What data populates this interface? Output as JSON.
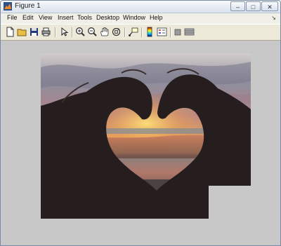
{
  "window": {
    "title": "Figure 1",
    "icon": "matlab-figure-icon",
    "controls": [
      "minimize-icon",
      "maximize-icon",
      "close-icon"
    ]
  },
  "menubar": {
    "items": [
      "File",
      "Edit",
      "View",
      "Insert",
      "Tools",
      "Desktop",
      "Window",
      "Help"
    ],
    "overflow_icon": "arrow-icon"
  },
  "toolbar": {
    "buttons": [
      "new-figure-icon",
      "open-file-icon",
      "save-icon",
      "print-icon",
      "edit-plot-icon",
      "zoom-in-icon",
      "zoom-out-icon",
      "pan-icon",
      "rotate-3d-icon",
      "data-cursor-icon",
      "colorbar-icon",
      "legend-icon",
      "hide-plot-tools-icon",
      "show-plot-tools-icon"
    ]
  },
  "figure": {
    "background": "#c8c8c8",
    "image_content": "hands-heart-sunset-photo"
  }
}
